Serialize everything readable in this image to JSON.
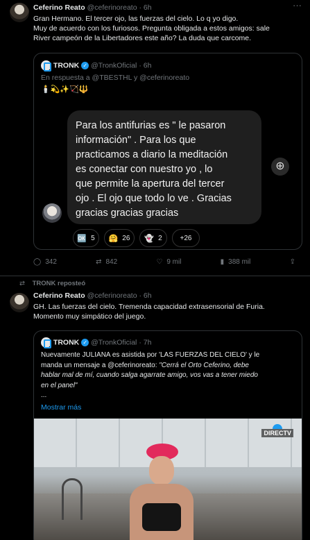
{
  "tweet1": {
    "author_name": "Ceferino Reato",
    "author_handle": "@ceferinoreato",
    "time": "6h",
    "text_lines": [
      "Gran Hermano. El tercer ojo, las fuerzas del cielo. Lo q yo digo.",
      "Muy de acuerdo con los furiosos. Pregunta obligada a estos amigos: sale",
      "River campeón de la Libertadores este año? La duda que carcome."
    ],
    "quote": {
      "author_name": "TRONK",
      "author_handle": "@TronkOficial",
      "time": "6h",
      "reply_to": "En respuesta a @TBESTHL y @ceferinoreato",
      "emoji_line": "🕯️💫✨🏹🔱",
      "bubble_lines": [
        "Para los antifurias es \" le pasaron",
        "información\"  . Para los que",
        "practicamos a diario la meditación",
        "es conectar con nuestro yo ,  lo",
        "que permite la apertura del tercer",
        "ojo . El ojo que todo lo ve . Gracias",
        "gracias gracias gracias"
      ],
      "reactions": [
        {
          "emoji": "🆗",
          "count": "5"
        },
        {
          "emoji": "🤗",
          "count": "26"
        },
        {
          "emoji": "👻",
          "count": "2"
        },
        {
          "emoji": "",
          "count": "+26"
        }
      ]
    },
    "stats": {
      "replies": "342",
      "reposts": "842",
      "likes": "9 mil",
      "views": "388 mil"
    }
  },
  "tweet2": {
    "repost_label": "TRONK reposteó",
    "author_name": "Ceferino Reato",
    "author_handle": "@ceferinoreato",
    "time": "6h",
    "text_lines": [
      "GH. Las fuerzas del cielo. Tremenda capacidad extrasensorial de Furia.",
      "Momento muy simpático del juego."
    ],
    "quote": {
      "author_name": "TRONK",
      "author_handle": "@TronkOficial",
      "time": "7h",
      "line1": "Nuevamente JULIANA es asistida por 'LAS FUERZAS DEL CIELO' y le",
      "line2_prefix": "manda un mensaje a @ceferinoreato: ",
      "line2_quote": "\"Cerrá el Orto Ceferino, debe",
      "line3": "hablar mal de mí, cuando salga agarrate amigo, vos vas a tener miedo",
      "line4": "en el panel\"",
      "ellipsis": "...",
      "show_more": "Mostrar más",
      "broadcast_logo": "DIRECTV"
    }
  },
  "colors": {
    "accent": "#1d9bf0",
    "muted": "#71767b",
    "border": "#2f3336",
    "background": "#000000"
  }
}
